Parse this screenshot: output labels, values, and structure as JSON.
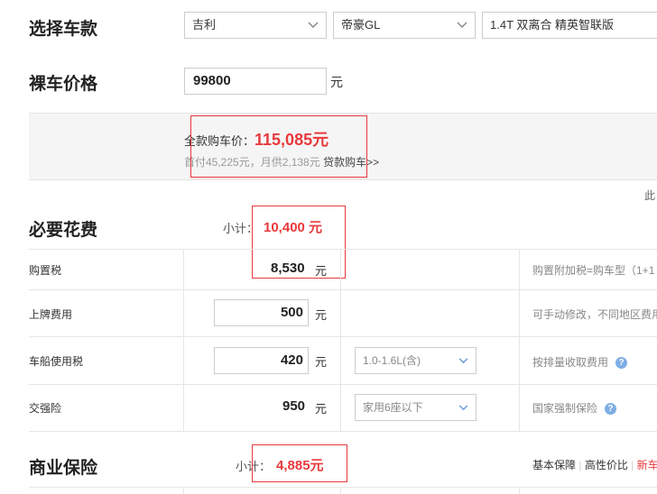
{
  "select_car": {
    "title": "选择车款",
    "brand": "吉利",
    "series": "帝豪GL",
    "model": "1.4T 双离合 精英智联版"
  },
  "bare_price": {
    "title": "裸车价格",
    "value": "99800",
    "unit": "元"
  },
  "summary": {
    "full_label": "全款购车价：",
    "full_value": "115,085元",
    "loan_text": "首付45,225元，月供2,138元",
    "loan_link": "贷款购车>>"
  },
  "edge_text": "此",
  "necessary": {
    "title": "必要花费",
    "subtotal_label": "小计：",
    "subtotal_value": "10,400 元",
    "rows": [
      {
        "label": "购置税",
        "value": "8,530",
        "unit": "元",
        "note": "购置附加税=购车型（1+1"
      },
      {
        "label": "上牌费用",
        "value": "500",
        "unit": "元",
        "note": "可手动修改，不同地区费用"
      },
      {
        "label": "车船使用税",
        "value": "420",
        "unit": "元",
        "option": "1.0-1.6L(含)",
        "note": "按排量收取费用"
      },
      {
        "label": "交强险",
        "value": "950",
        "unit": "元",
        "option": "家用6座以下",
        "note": "国家强制保险"
      }
    ]
  },
  "commercial": {
    "title": "商业保险",
    "subtotal_label": "小计：",
    "subtotal_value": "4,885元",
    "links": [
      "基本保障",
      "高性价比",
      "新车"
    ]
  },
  "colors": {
    "accent_red": "#e8393c",
    "help_blue": "#7eaee4"
  }
}
